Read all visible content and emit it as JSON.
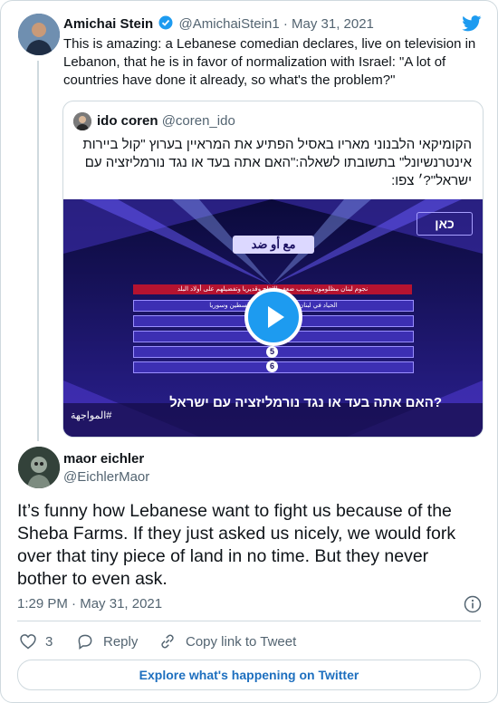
{
  "colors": {
    "twitter_blue": "#1d9bf0",
    "link_blue": "#1d6fbf",
    "muted": "#536471"
  },
  "main_tweet": {
    "name": "Amichai Stein",
    "handle": "@AmichaiStein1",
    "sep": "·",
    "date": "May 31, 2021",
    "text": "This is amazing: a Lebanese comedian declares, live on television in Lebanon, that he is in favor of normalization with Israel: \"A lot of countries have done it already, so what's the problem?\""
  },
  "quoted_tweet": {
    "name": "ido coren",
    "handle": "@coren_ido",
    "text_lines": [
      "הקומיקאי הלבנוני מאריו באסיל הפתיע את המראיין בערוץ \"קול ביירות",
      "אינטרנשיונל\" בתשובתו לשאלה:\"האם אתה בעד או נגד נורמליזציה עם",
      "ישראל\"?׳ צפו:"
    ],
    "video": {
      "title_banner": "مع أو ضد",
      "channel_logo": "כאן",
      "row_texts": [
        "نجوم لبنان مظلومون بسبب ضعف الإنتاج وقديريا وتفضيلهم على أولاد البلد",
        "الحياد في لبنان وفصله عن قضية فلسطين وسوريا",
        "",
        "",
        "5",
        "6"
      ],
      "hashtag": "#المواجهة",
      "subtitle": "?האם אתה בעד או נגד נורמליזציה עם ישראל"
    }
  },
  "reply_tweet": {
    "name": "maor eichler",
    "handle": "@EichlerMaor",
    "text": "It’s funny how Lebanese want to fight us because of the Sheba Farms. If they just asked us nicely, we would fork over that tiny piece of land in no time. But they never bother to even ask.",
    "time": "1:29 PM",
    "sep": "·",
    "date": "May 31, 2021"
  },
  "actions": {
    "like_count": "3",
    "reply_label": "Reply",
    "copy_label": "Copy link to Tweet"
  },
  "footer": {
    "explore_label": "Explore what's happening on Twitter"
  }
}
